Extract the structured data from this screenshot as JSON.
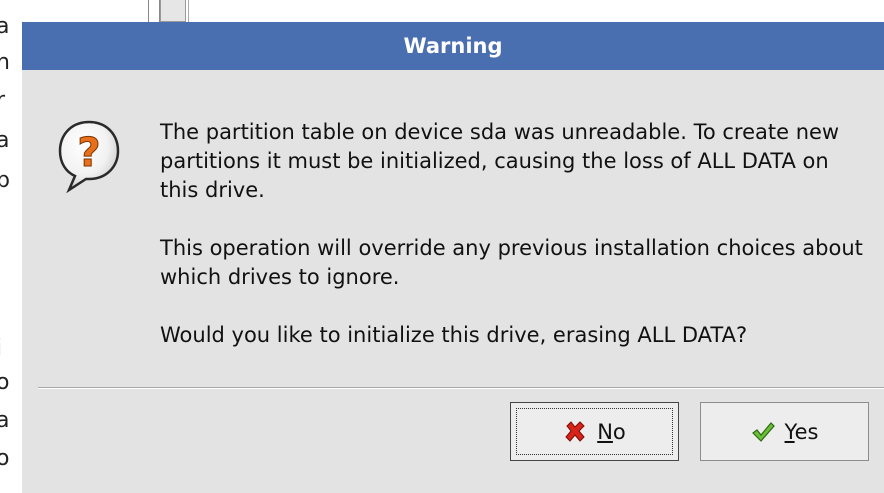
{
  "background": {
    "left_chars": [
      "a",
      "n",
      "r",
      "a",
      "p",
      "i",
      "o",
      "a",
      "o"
    ]
  },
  "dialog": {
    "title": "Warning",
    "icon": "question-bubble-icon",
    "message": [
      "The partition table on device sda was unreadable. To create new partitions it must be initialized, causing the loss of ALL DATA on this drive.",
      "This operation will override any previous installation choices about which drives to ignore.",
      "Would you like to initialize this drive, erasing ALL DATA?"
    ],
    "buttons": {
      "no": {
        "mnemonic": "N",
        "rest": "o",
        "icon": "red-x-icon",
        "focused": true
      },
      "yes": {
        "mnemonic": "Y",
        "rest": "es",
        "icon": "green-checkmark-icon"
      }
    }
  },
  "colors": {
    "titlebar": "#4a6fb0",
    "dialog_bg": "#e3e3e3",
    "question_orange": "#e8701a"
  }
}
